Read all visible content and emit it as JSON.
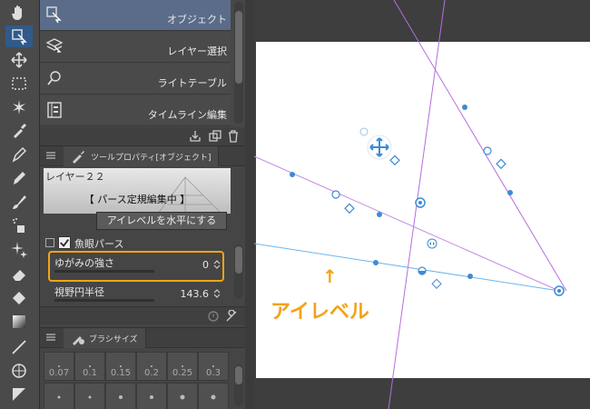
{
  "subtool": {
    "items": [
      {
        "label": "オブジェクト",
        "icon": "object-select-icon"
      },
      {
        "label": "レイヤー選択",
        "icon": "layer-select-icon"
      },
      {
        "label": "ライトテーブル",
        "icon": "light-table-icon"
      },
      {
        "label": "タイムライン編集",
        "icon": "timeline-edit-icon"
      }
    ]
  },
  "toolprop": {
    "tab": "ツールプロパティ[オブジェクト]",
    "layer_name": "レイヤー２２",
    "status": "【 パース定規編集中 】",
    "level_button": "アイレベルを水平にする",
    "fisheye_label": "魚眼パース",
    "distortion_label": "ゆがみの強さ",
    "distortion_value": "0",
    "view_radius_label": "視野円半径",
    "view_radius_value": "143.6"
  },
  "brush": {
    "tab": "ブラシサイズ",
    "sizes": [
      "0.07",
      "0.1",
      "0.15",
      "0.2",
      "0.25",
      "0.3"
    ]
  },
  "canvas": {
    "arrow": "↑",
    "eye_level_label": "アイレベル"
  },
  "colors": {
    "accent": "#f3a317",
    "guide_purple": "#b46ee0",
    "eye_level_blue": "#6bb6ef",
    "handle_blue": "#3d8bd1"
  }
}
